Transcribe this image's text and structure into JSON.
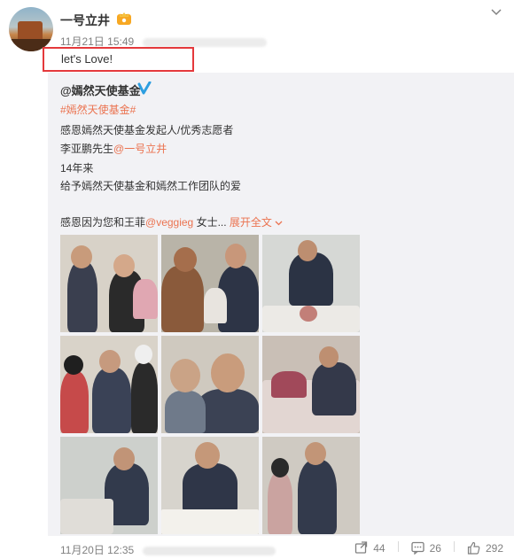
{
  "post": {
    "username": "一号立井",
    "timestamp": "11月21日 15:49",
    "text": "let's Love!"
  },
  "repost": {
    "author": "@嫣然天使基金",
    "hashtag": "#嫣然天使基金#",
    "lines": [
      "感恩嫣然天使基金发起人/优秀志愿者",
      "14年来",
      "给予嫣然天使基金和嫣然工作团队的爱"
    ],
    "mention_line_prefix": "李亚鹏先生",
    "mention_line_link": "@一号立井",
    "last_line_prefix": "感恩因为您和王菲",
    "last_line_link": "@veggieg",
    "last_line_suffix": " 女士...",
    "expand_label": "展开全文",
    "footer_time": "11月20日 12:35"
  },
  "actions": {
    "repost_count": "44",
    "comment_count": "26",
    "like_count": "292"
  },
  "colors": {
    "link": "#eb7350",
    "highlight_border": "#e4393c",
    "repost_bg": "#f2f2f5"
  }
}
